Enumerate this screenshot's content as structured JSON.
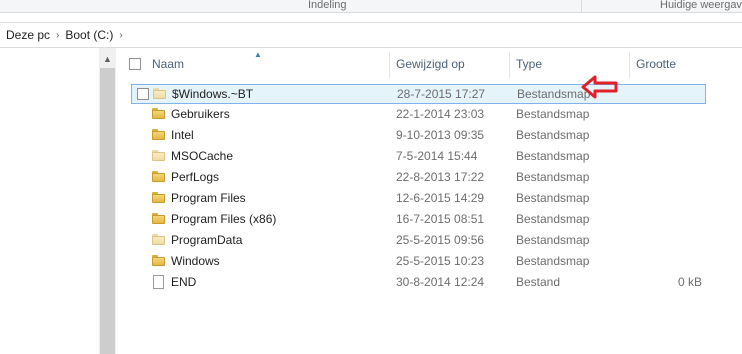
{
  "ribbon": {
    "group_indeling": "Indeling",
    "group_huidige": "Huidige weergave"
  },
  "address_bar": {
    "crumbs": [
      "Deze pc",
      "Boot (C:)"
    ]
  },
  "columns": {
    "name": "Naam",
    "date": "Gewijzigd op",
    "type": "Type",
    "size": "Grootte"
  },
  "rows": [
    {
      "name": "$Windows.~BT",
      "date": "28-7-2015 17:27",
      "type": "Bestandsmap",
      "size": "",
      "icon": "folder-light-icon",
      "selected": true
    },
    {
      "name": "Gebruikers",
      "date": "22-1-2014 23:03",
      "type": "Bestandsmap",
      "size": "",
      "icon": "folder-icon"
    },
    {
      "name": "Intel",
      "date": "9-10-2013 09:35",
      "type": "Bestandsmap",
      "size": "",
      "icon": "folder-icon"
    },
    {
      "name": "MSOCache",
      "date": "7-5-2014 15:44",
      "type": "Bestandsmap",
      "size": "",
      "icon": "folder-light-icon"
    },
    {
      "name": "PerfLogs",
      "date": "22-8-2013 17:22",
      "type": "Bestandsmap",
      "size": "",
      "icon": "folder-icon"
    },
    {
      "name": "Program Files",
      "date": "12-6-2015 14:29",
      "type": "Bestandsmap",
      "size": "",
      "icon": "folder-icon"
    },
    {
      "name": "Program Files (x86)",
      "date": "16-7-2015 08:51",
      "type": "Bestandsmap",
      "size": "",
      "icon": "folder-icon"
    },
    {
      "name": "ProgramData",
      "date": "25-5-2015 09:56",
      "type": "Bestandsmap",
      "size": "",
      "icon": "folder-light-icon"
    },
    {
      "name": "Windows",
      "date": "25-5-2015 10:23",
      "type": "Bestandsmap",
      "size": "",
      "icon": "folder-icon"
    },
    {
      "name": "END",
      "date": "30-8-2014 12:24",
      "type": "Bestand",
      "size": "0 kB",
      "icon": "file-icon"
    }
  ],
  "colors": {
    "selection_bg": "#e5f3fb",
    "selection_border": "#7eb4ea",
    "annotation_arrow": "#e0202a",
    "header_text": "#4c607a"
  }
}
